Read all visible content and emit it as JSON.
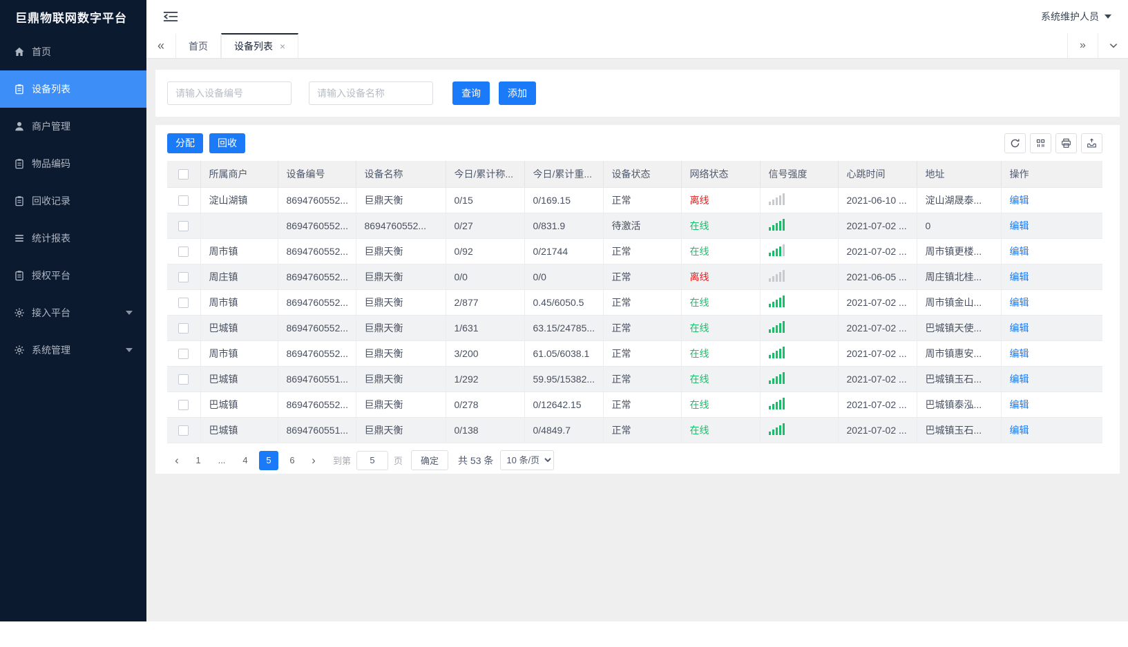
{
  "app": {
    "logo": "巨鼎物联网数字平台",
    "user": "系统维护人员"
  },
  "colors": {
    "sidebar_bg": "#0c1a30",
    "sidebar_active": "#3e8ef7",
    "primary_button": "#1a7af8",
    "online_green": "#19be6b",
    "offline_red": "#f21818",
    "signal_gray": "#c8cace",
    "page_bg": "#efefef"
  },
  "sidebar": {
    "items": [
      {
        "label": "首页",
        "icon": "home-icon",
        "active": false,
        "caret": false
      },
      {
        "label": "设备列表",
        "icon": "device-list-icon",
        "active": true,
        "caret": false
      },
      {
        "label": "商户管理",
        "icon": "merchant-icon",
        "active": false,
        "caret": false
      },
      {
        "label": "物品编码",
        "icon": "item-code-icon",
        "active": false,
        "caret": false
      },
      {
        "label": "回收记录",
        "icon": "recycle-record-icon",
        "active": false,
        "caret": false
      },
      {
        "label": "统计报表",
        "icon": "report-icon",
        "active": false,
        "caret": false
      },
      {
        "label": "授权平台",
        "icon": "authorize-icon",
        "active": false,
        "caret": false
      },
      {
        "label": "接入平台",
        "icon": "access-platform-icon",
        "active": false,
        "caret": true
      },
      {
        "label": "系统管理",
        "icon": "system-manage-icon",
        "active": false,
        "caret": true
      }
    ]
  },
  "tabs": {
    "scroll_left": "«",
    "scroll_right": "»",
    "close": "×",
    "items": [
      {
        "label": "首页",
        "active": false,
        "closable": false
      },
      {
        "label": "设备列表",
        "active": true,
        "closable": true
      }
    ]
  },
  "search": {
    "device_id_placeholder": "请输入设备编号",
    "device_name_placeholder": "请输入设备名称",
    "query_label": "查询",
    "add_label": "添加"
  },
  "toolbar": {
    "assign_label": "分配",
    "recycle_label": "回收",
    "icons": [
      "refresh-icon",
      "columns-icon",
      "print-icon",
      "export-icon"
    ]
  },
  "table": {
    "headers": [
      "所属商户",
      "设备编号",
      "设备名称",
      "今日/累计称...",
      "今日/累计重...",
      "设备状态",
      "网络状态",
      "信号强度",
      "心跳时间",
      "地址",
      "操作"
    ],
    "rows": [
      {
        "merchant": "淀山湖镇",
        "device_id": "8694760552...",
        "device_name": "巨鼎天衡",
        "today_count": "0/15",
        "today_weight": "0/169.15",
        "device_status": "正常",
        "network_status": "离线",
        "online": false,
        "signal": 0,
        "heartbeat": "2021-06-10 ...",
        "address": "淀山湖晟泰...",
        "action": "编辑"
      },
      {
        "merchant": "",
        "device_id": "8694760552...",
        "device_name": "8694760552...",
        "today_count": "0/27",
        "today_weight": "0/831.9",
        "device_status": "待激活",
        "network_status": "在线",
        "online": true,
        "signal": 5,
        "heartbeat": "2021-07-02 ...",
        "address": "0",
        "action": "编辑"
      },
      {
        "merchant": "周市镇",
        "device_id": "8694760552...",
        "device_name": "巨鼎天衡",
        "today_count": "0/92",
        "today_weight": "0/21744",
        "device_status": "正常",
        "network_status": "在线",
        "online": true,
        "signal": 4,
        "heartbeat": "2021-07-02 ...",
        "address": "周市镇更楼...",
        "action": "编辑"
      },
      {
        "merchant": "周庄镇",
        "device_id": "8694760552...",
        "device_name": "巨鼎天衡",
        "today_count": "0/0",
        "today_weight": "0/0",
        "device_status": "正常",
        "network_status": "离线",
        "online": false,
        "signal": 0,
        "heartbeat": "2021-06-05 ...",
        "address": "周庄镇北桂...",
        "action": "编辑"
      },
      {
        "merchant": "周市镇",
        "device_id": "8694760552...",
        "device_name": "巨鼎天衡",
        "today_count": "2/877",
        "today_weight": "0.45/6050.5",
        "device_status": "正常",
        "network_status": "在线",
        "online": true,
        "signal": 5,
        "heartbeat": "2021-07-02 ...",
        "address": "周市镇金山...",
        "action": "编辑"
      },
      {
        "merchant": "巴城镇",
        "device_id": "8694760552...",
        "device_name": "巨鼎天衡",
        "today_count": "1/631",
        "today_weight": "63.15/24785...",
        "device_status": "正常",
        "network_status": "在线",
        "online": true,
        "signal": 5,
        "heartbeat": "2021-07-02 ...",
        "address": "巴城镇天使...",
        "action": "编辑"
      },
      {
        "merchant": "周市镇",
        "device_id": "8694760552...",
        "device_name": "巨鼎天衡",
        "today_count": "3/200",
        "today_weight": "61.05/6038.1",
        "device_status": "正常",
        "network_status": "在线",
        "online": true,
        "signal": 5,
        "heartbeat": "2021-07-02 ...",
        "address": "周市镇惠安...",
        "action": "编辑"
      },
      {
        "merchant": "巴城镇",
        "device_id": "8694760551...",
        "device_name": "巨鼎天衡",
        "today_count": "1/292",
        "today_weight": "59.95/15382...",
        "device_status": "正常",
        "network_status": "在线",
        "online": true,
        "signal": 5,
        "heartbeat": "2021-07-02 ...",
        "address": "巴城镇玉石...",
        "action": "编辑"
      },
      {
        "merchant": "巴城镇",
        "device_id": "8694760552...",
        "device_name": "巨鼎天衡",
        "today_count": "0/278",
        "today_weight": "0/12642.15",
        "device_status": "正常",
        "network_status": "在线",
        "online": true,
        "signal": 5,
        "heartbeat": "2021-07-02 ...",
        "address": "巴城镇泰泓...",
        "action": "编辑"
      },
      {
        "merchant": "巴城镇",
        "device_id": "8694760551...",
        "device_name": "巨鼎天衡",
        "today_count": "0/138",
        "today_weight": "0/4849.7",
        "device_status": "正常",
        "network_status": "在线",
        "online": true,
        "signal": 5,
        "heartbeat": "2021-07-02 ...",
        "address": "巴城镇玉石...",
        "action": "编辑"
      }
    ]
  },
  "pagination": {
    "prev_icon": "‹",
    "next_icon": "›",
    "pages": [
      {
        "label": "1",
        "active": false
      },
      {
        "label": "...",
        "active": false
      },
      {
        "label": "4",
        "active": false
      },
      {
        "label": "5",
        "active": true
      },
      {
        "label": "6",
        "active": false
      }
    ],
    "goto_label": "到第",
    "goto_value": "5",
    "page_label": "页",
    "confirm_label": "确定",
    "total_label": "共 53 条",
    "page_size_label": "10 条/页"
  }
}
